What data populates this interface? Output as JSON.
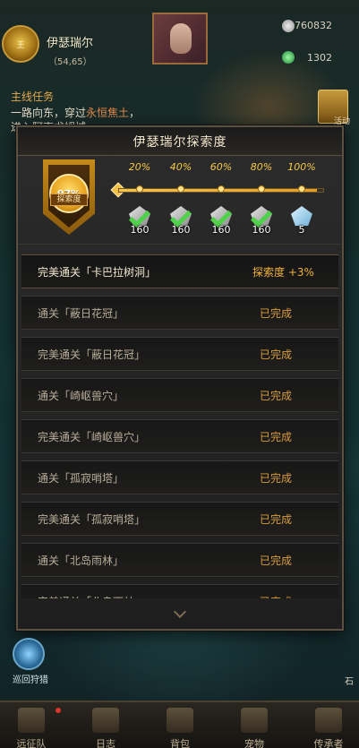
{
  "player": {
    "name": "伊瑟瑞尔",
    "coords": "（54,65）",
    "avatar_text": "王"
  },
  "resources": [
    {
      "icon": "silver-coin-icon",
      "value": "760832"
    },
    {
      "icon": "green-gem-icon",
      "value": "1302"
    }
  ],
  "quest": {
    "title": "主线任务",
    "line1_pre": "一路向东，穿过",
    "line1_hl": "永恒焦土",
    "line1_post": "，",
    "line2": "进入阿克尤姆城"
  },
  "activity_label": "活动",
  "dialog": {
    "title": "伊瑟瑞尔探索度",
    "progress": 97,
    "progress_text": "97%",
    "badge_label": "探索度",
    "milestones": [
      {
        "pct": "20%",
        "reward": "160",
        "claimed": true,
        "icon": "silver-gem-icon"
      },
      {
        "pct": "40%",
        "reward": "160",
        "claimed": true,
        "icon": "silver-gem-icon"
      },
      {
        "pct": "60%",
        "reward": "160",
        "claimed": true,
        "icon": "silver-gem-icon"
      },
      {
        "pct": "80%",
        "reward": "160",
        "claimed": true,
        "icon": "silver-gem-icon"
      },
      {
        "pct": "100%",
        "reward": "5",
        "claimed": false,
        "icon": "blue-crystal-icon"
      }
    ],
    "tasks": [
      {
        "label": "完美通关「卡巴拉树洞」",
        "status": "探索度 +3%",
        "active": true
      },
      {
        "label": "通关「蔽日花冠」",
        "status": "已完成",
        "active": false
      },
      {
        "label": "完美通关「蔽日花冠」",
        "status": "已完成",
        "active": false
      },
      {
        "label": "通关「崎岖兽穴」",
        "status": "已完成",
        "active": false
      },
      {
        "label": "完美通关「崎岖兽穴」",
        "status": "已完成",
        "active": false
      },
      {
        "label": "通关「孤寂哨塔」",
        "status": "已完成",
        "active": false
      },
      {
        "label": "完美通关「孤寂哨塔」",
        "status": "已完成",
        "active": false
      },
      {
        "label": "通关「北岛雨林」",
        "status": "已完成",
        "active": false
      },
      {
        "label": "完美通关「北岛雨林」",
        "status": "已完成",
        "active": false
      }
    ]
  },
  "side_left_label": "巡回狩猎",
  "side_right_label": "石",
  "nav": [
    {
      "label": "远征队",
      "icon": "horned-helmet-icon",
      "dot": true
    },
    {
      "label": "日志",
      "icon": "scroll-icon",
      "dot": false
    },
    {
      "label": "背包",
      "icon": "bag-icon",
      "dot": false
    },
    {
      "label": "宠物",
      "icon": "pet-icon",
      "dot": false
    },
    {
      "label": "传承者",
      "icon": "crossed-swords-icon",
      "dot": false
    }
  ]
}
